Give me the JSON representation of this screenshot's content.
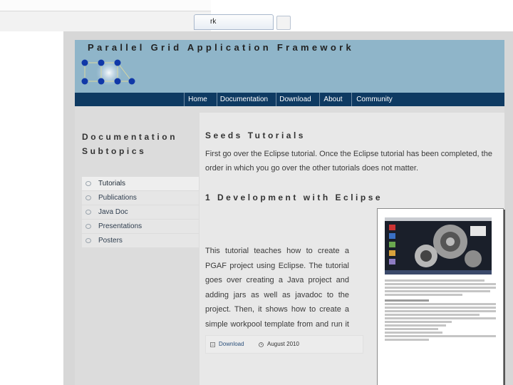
{
  "browser": {
    "tab_title": "rk"
  },
  "site": {
    "title": "Parallel Grid Application Framework"
  },
  "nav": {
    "items": [
      "Home",
      "Documentation",
      "Download",
      "About",
      "Community"
    ]
  },
  "sidebar": {
    "title_line1": "Documentation",
    "title_line2": "Subtopics",
    "items": [
      "Tutorials",
      "Publications",
      "Java Doc",
      "Presentations",
      "Posters"
    ]
  },
  "content": {
    "title": "Seeds Tutorials",
    "intro": "First go over the Eclipse tutorial. Once the Eclipse tutorial has been completed, the order in which you go over the other tutorials does not matter.",
    "section_title": "1  Development with Eclipse",
    "description": "This tutorial teaches how to create a PGAF project using Eclipse. The tutorial goes over creating a Java project and adding jars as well as javadoc to the project. Then, it shows how to create a simple workpool template from and run it using Seeds on a Grid.",
    "download_label": "Download",
    "date": "August 2010"
  }
}
